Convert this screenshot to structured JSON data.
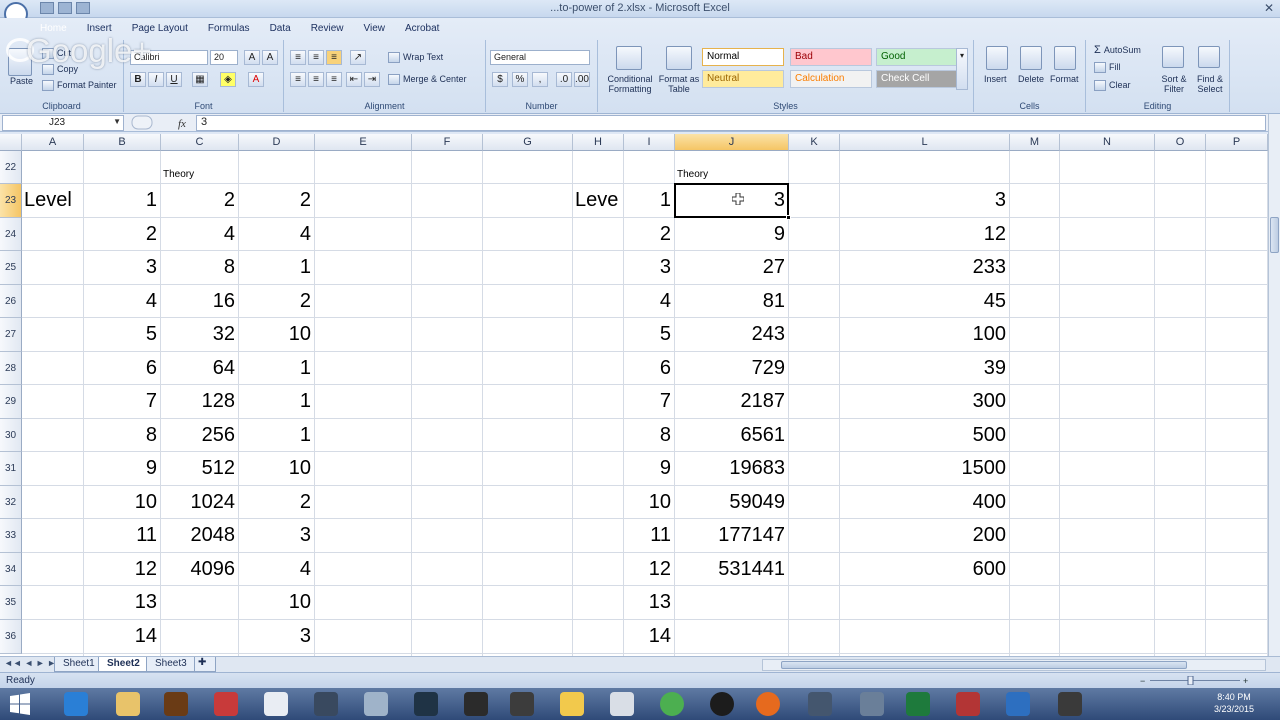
{
  "window": {
    "title": "...to-power of 2.xlsx - Microsoft Excel"
  },
  "ribbon": {
    "tabs": [
      "Home",
      "Insert",
      "Page Layout",
      "Formulas",
      "Data",
      "Review",
      "View",
      "Acrobat"
    ],
    "clipboard": {
      "paste": "Paste",
      "cut": "Cut",
      "copy": "Copy",
      "format_painter": "Format Painter",
      "label": "Clipboard"
    },
    "font": {
      "name": "Calibri",
      "size": "20",
      "label": "Font"
    },
    "alignment": {
      "wrap_text": "Wrap Text",
      "merge_center": "Merge & Center",
      "label": "Alignment"
    },
    "number": {
      "format": "General",
      "label": "Number"
    },
    "styles": {
      "conditional_formatting": "Conditional Formatting",
      "format_as_table": "Format as Table",
      "cells": [
        {
          "name": "Normal",
          "bg": "#ffffff",
          "fg": "#000000"
        },
        {
          "name": "Bad",
          "bg": "#ffc7ce",
          "fg": "#9c0006"
        },
        {
          "name": "Good",
          "bg": "#c6efce",
          "fg": "#006100"
        },
        {
          "name": "Neutral",
          "bg": "#ffeb9c",
          "fg": "#9c6500"
        },
        {
          "name": "Calculation",
          "bg": "#f2f2f2",
          "fg": "#fa7d00"
        },
        {
          "name": "Check Cell",
          "bg": "#a5a5a5",
          "fg": "#ffffff"
        }
      ],
      "label": "Styles"
    },
    "cells": {
      "insert": "Insert",
      "delete": "Delete",
      "format": "Format",
      "label": "Cells"
    },
    "editing": {
      "autosum": "AutoSum",
      "fill": "Fill",
      "clear": "Clear",
      "sort_filter": "Sort & Filter",
      "find_select": "Find & Select",
      "label": "Editing"
    }
  },
  "overlay": {
    "text": "Google+"
  },
  "formula_bar": {
    "name_box": "J23",
    "fx": "fx",
    "value": "3"
  },
  "grid": {
    "columns": [
      "A",
      "B",
      "C",
      "D",
      "E",
      "F",
      "G",
      "H",
      "I",
      "J",
      "K",
      "L",
      "M",
      "N",
      "O",
      "P"
    ],
    "selected_column": "J",
    "rows": [
      "22",
      "23",
      "24",
      "25",
      "26",
      "27",
      "28",
      "29",
      "30",
      "31",
      "32",
      "33",
      "34",
      "35",
      "36"
    ],
    "selected_row": "23",
    "header_theory_left": "Theory",
    "header_theory_right": "Theory",
    "label_left": "Level",
    "label_right": "Leve",
    "col_b": [
      "1",
      "2",
      "3",
      "4",
      "5",
      "6",
      "7",
      "8",
      "9",
      "10",
      "11",
      "12",
      "13",
      "14"
    ],
    "col_c": [
      "2",
      "4",
      "8",
      "16",
      "32",
      "64",
      "128",
      "256",
      "512",
      "1024",
      "2048",
      "4096",
      "",
      ""
    ],
    "col_d": [
      "2",
      "4",
      "1",
      "2",
      "10",
      "1",
      "1",
      "1",
      "10",
      "2",
      "3",
      "4",
      "10",
      "3"
    ],
    "col_i": [
      "1",
      "2",
      "3",
      "4",
      "5",
      "6",
      "7",
      "8",
      "9",
      "10",
      "11",
      "12",
      "13",
      "14"
    ],
    "col_j": [
      "3",
      "9",
      "27",
      "81",
      "243",
      "729",
      "2187",
      "6561",
      "19683",
      "59049",
      "177147",
      "531441",
      "",
      ""
    ],
    "col_l": [
      "3",
      "12",
      "233",
      "45",
      "100",
      "39",
      "300",
      "500",
      "1500",
      "400",
      "200",
      "600",
      "",
      ""
    ]
  },
  "sheets": {
    "tabs": [
      "Sheet1",
      "Sheet2",
      "Sheet3"
    ],
    "active": "Sheet2"
  },
  "status": {
    "ready": "Ready"
  },
  "clock": {
    "time": "8:40 PM",
    "date": "3/23/2015"
  }
}
